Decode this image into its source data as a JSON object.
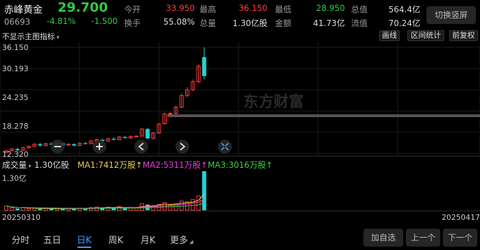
{
  "header": {
    "name": "赤峰黄金",
    "price": "29.700",
    "code": "06693",
    "change_pct": "-4.81%",
    "change": "-1.500",
    "switch_label": "切换竖屏",
    "stats": [
      {
        "label": "今开",
        "value": "33.950",
        "color": "red"
      },
      {
        "label": "最高",
        "value": "36.150",
        "color": "red"
      },
      {
        "label": "最低",
        "value": "28.950",
        "color": "green"
      },
      {
        "label": "总值",
        "value": "564.4亿",
        "color": "white"
      },
      {
        "label": "换手",
        "value": "55.08%",
        "color": "white"
      },
      {
        "label": "总量",
        "value": "1.30亿股",
        "color": "white"
      },
      {
        "label": "金额",
        "value": "41.73亿",
        "color": "white"
      },
      {
        "label": "流值",
        "value": "70.24亿",
        "color": "white"
      }
    ]
  },
  "toolbar": {
    "indicator_dropdown": "不显示主图指标",
    "draw_line": "画线",
    "range_stats": "区间统计",
    "restore_right": "前复权"
  },
  "price_axis": [
    "36.150",
    "30.193",
    "24.235",
    "18.278",
    "12.320"
  ],
  "volume_bar": {
    "label": "成交量",
    "vol": "1.30亿股",
    "ma1": "MA1:7412万股",
    "ma2": "MA2:5311万股",
    "ma3": "MA3:3016万股",
    "arrow": "↑",
    "axis_top": "1.30亿"
  },
  "watermark": "东方财富",
  "date_start": "20250310",
  "date_end": "20250417",
  "bottom_tabs": [
    "分时",
    "五日",
    "日K",
    "周K",
    "月K",
    "更多"
  ],
  "active_tab": "日K",
  "bottom_buttons": {
    "add": "加自选",
    "prev": "上一个",
    "next": "下一个"
  },
  "colors": {
    "up": "#ff3b3b",
    "down": "#2ecc40",
    "candle_down": "#21d4d4",
    "ma1": "#f0d050",
    "ma2": "#e040e0",
    "ma3": "#40d040",
    "accent": "#3aa0ff"
  },
  "chart_data": {
    "type": "candlestick",
    "ylim": [
      12.32,
      36.15
    ],
    "candles": [
      {
        "o": 12.6,
        "c": 12.9,
        "h": 13.1,
        "l": 12.4
      },
      {
        "o": 12.9,
        "c": 13.3,
        "h": 13.5,
        "l": 12.8
      },
      {
        "o": 13.3,
        "c": 13.0,
        "h": 13.6,
        "l": 12.9
      },
      {
        "o": 13.0,
        "c": 13.6,
        "h": 13.8,
        "l": 12.9
      },
      {
        "o": 13.6,
        "c": 13.9,
        "h": 14.1,
        "l": 13.4
      },
      {
        "o": 13.9,
        "c": 14.4,
        "h": 14.6,
        "l": 13.7
      },
      {
        "o": 14.4,
        "c": 14.1,
        "h": 14.7,
        "l": 13.9
      },
      {
        "o": 14.1,
        "c": 14.5,
        "h": 14.7,
        "l": 13.9
      },
      {
        "o": 14.5,
        "c": 14.3,
        "h": 14.8,
        "l": 14.1
      },
      {
        "o": 14.3,
        "c": 14.6,
        "h": 14.8,
        "l": 14.1
      },
      {
        "o": 14.6,
        "c": 14.2,
        "h": 14.8,
        "l": 14.0
      },
      {
        "o": 14.2,
        "c": 14.4,
        "h": 14.6,
        "l": 14.0
      },
      {
        "o": 14.4,
        "c": 14.1,
        "h": 14.6,
        "l": 13.9
      },
      {
        "o": 14.1,
        "c": 14.6,
        "h": 14.8,
        "l": 14.0
      },
      {
        "o": 14.6,
        "c": 14.5,
        "h": 14.9,
        "l": 14.3
      },
      {
        "o": 14.5,
        "c": 15.1,
        "h": 15.3,
        "l": 14.4
      },
      {
        "o": 15.1,
        "c": 15.4,
        "h": 15.6,
        "l": 14.9
      },
      {
        "o": 15.4,
        "c": 15.1,
        "h": 15.6,
        "l": 14.9
      },
      {
        "o": 15.1,
        "c": 15.6,
        "h": 15.8,
        "l": 15.0
      },
      {
        "o": 15.6,
        "c": 15.4,
        "h": 15.9,
        "l": 15.2
      },
      {
        "o": 15.4,
        "c": 16.0,
        "h": 16.3,
        "l": 15.3
      },
      {
        "o": 16.0,
        "c": 15.8,
        "h": 16.3,
        "l": 15.6
      },
      {
        "o": 15.8,
        "c": 16.1,
        "h": 16.4,
        "l": 15.6
      },
      {
        "o": 16.1,
        "c": 16.2,
        "h": 16.4,
        "l": 15.9
      },
      {
        "o": 16.2,
        "c": 17.8,
        "h": 18.0,
        "l": 16.1
      },
      {
        "o": 17.8,
        "c": 15.7,
        "h": 18.0,
        "l": 15.5
      },
      {
        "o": 15.7,
        "c": 16.9,
        "h": 17.1,
        "l": 15.5
      },
      {
        "o": 16.9,
        "c": 18.9,
        "h": 19.2,
        "l": 16.8
      },
      {
        "o": 19.0,
        "c": 21.2,
        "h": 21.5,
        "l": 18.8
      },
      {
        "o": 21.2,
        "c": 21.3,
        "h": 21.6,
        "l": 20.9
      },
      {
        "o": 21.3,
        "c": 22.7,
        "h": 23.0,
        "l": 21.1
      },
      {
        "o": 22.7,
        "c": 25.3,
        "h": 25.8,
        "l": 22.5
      },
      {
        "o": 25.3,
        "c": 26.6,
        "h": 27.2,
        "l": 24.9
      },
      {
        "o": 26.6,
        "c": 28.4,
        "h": 28.9,
        "l": 26.3
      },
      {
        "o": 28.4,
        "c": 31.9,
        "h": 32.3,
        "l": 28.2
      },
      {
        "o": 33.95,
        "c": 29.7,
        "h": 36.15,
        "l": 28.95
      }
    ],
    "volumes": [
      0.14,
      0.08,
      0.06,
      0.08,
      0.06,
      0.07,
      0.05,
      0.06,
      0.05,
      0.05,
      0.05,
      0.06,
      0.05,
      0.07,
      0.06,
      0.09,
      0.11,
      0.09,
      0.1,
      0.07,
      0.12,
      0.09,
      0.09,
      0.08,
      0.22,
      0.19,
      0.15,
      0.2,
      0.26,
      0.18,
      0.22,
      0.31,
      0.28,
      0.36,
      0.48,
      1.3
    ],
    "vol_ylim": [
      0,
      1.3
    ]
  }
}
